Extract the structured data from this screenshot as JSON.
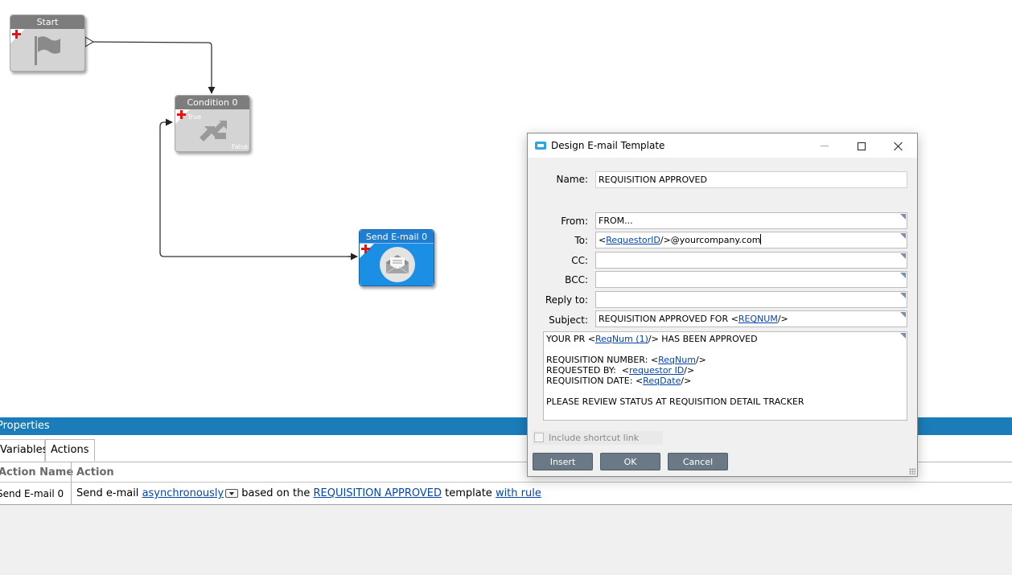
{
  "canvas": {
    "nodes": {
      "start": {
        "title": "Start",
        "icon": "flag-icon"
      },
      "condition": {
        "title": "Condition 0",
        "true_label": "True",
        "false_label": "False",
        "icon": "branch-arrow-icon"
      },
      "send_email": {
        "title": "Send E-mail 0",
        "icon": "envelope-icon"
      }
    }
  },
  "properties": {
    "header": "Properties",
    "tabs": [
      "Variables",
      "Actions"
    ],
    "active_tab": "Actions",
    "columns": [
      "Action Name",
      "Action"
    ],
    "row": {
      "name": "Send E-mail 0",
      "text_1": "Send e-mail ",
      "link_mode": "asynchronously",
      "text_2": " based on the ",
      "link_template": "REQUISITION APPROVED",
      "text_3": " template ",
      "link_rule": "with rule"
    }
  },
  "dialog": {
    "title": "Design E-mail Template",
    "labels": {
      "name": "Name:",
      "from": "From:",
      "to": "To:",
      "cc": "CC:",
      "bcc": "BCC:",
      "reply_to": "Reply to:",
      "subject": "Subject:"
    },
    "fields": {
      "name": "REQUISITION APPROVED",
      "from": "FROM...",
      "to": {
        "pre": "<",
        "tag": "RequestorID",
        "post": "/>@yourcompany.com"
      },
      "cc": "",
      "bcc": "",
      "reply_to": "",
      "subject": {
        "pre": "REQUISITION APPROVED FOR <",
        "tag": "REQNUM",
        "post": "/>"
      }
    },
    "body": {
      "line1": {
        "pre": "YOUR PR <",
        "tag": "ReqNum (1)",
        "post": "/> HAS BEEN APPROVED"
      },
      "line2": {
        "pre": "REQUISITION NUMBER: <",
        "tag": "ReqNum",
        "post": "/>"
      },
      "line3": {
        "pre": "REQUESTED BY:  <",
        "tag": "requestor ID",
        "post": "/>"
      },
      "line4": {
        "pre": "REQUISITION DATE: <",
        "tag": "ReqDate",
        "post": "/>"
      },
      "line5": "PLEASE REVIEW STATUS AT REQUISITION DETAIL TRACKER"
    },
    "shortcut_label": "Include shortcut link",
    "buttons": {
      "insert": "Insert",
      "ok": "OK",
      "cancel": "Cancel"
    }
  },
  "colors": {
    "accent": "#1a7db9",
    "node_blue": "#1b8fe3",
    "node_grey": "#d4d4d4",
    "button": "#6a7985",
    "link": "#0645ad",
    "add_mark": "#e11111"
  }
}
